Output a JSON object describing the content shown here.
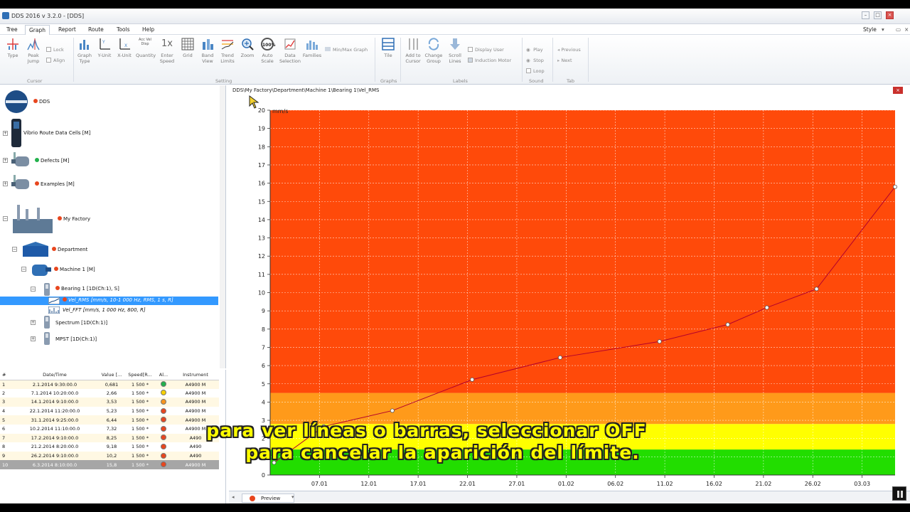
{
  "window": {
    "title": "DDS 2016 v 3.2.0 - [DDS]",
    "style_label": "Style"
  },
  "menu": {
    "tabs": [
      "Tree",
      "Graph",
      "Report",
      "Route",
      "Tools",
      "Help"
    ],
    "active": "Graph"
  },
  "ribbon": {
    "cursor": {
      "type": "Type",
      "peak_jump": "Peak Jump",
      "lock": "Lock",
      "align": "Align",
      "group": "Cursor"
    },
    "setting": {
      "graph_type": "Graph Type",
      "y_unit": "Y-Unit",
      "x_unit": "X-Unit",
      "quantity": "Quantity",
      "quantity_icon": "Acc Vel Disp",
      "enter_speed": "Enter Speed",
      "enter_speed_icon": "1x",
      "grid": "Grid",
      "band_view": "Band View",
      "trend_limits": "Trend Limits",
      "zoom": "Zoom",
      "auto_scale": "Auto Scale",
      "auto_scale_icon": "100%",
      "data_selection": "Data Selection",
      "families": "Families",
      "minmax": "Min/Max Graph",
      "group": "Setting"
    },
    "graphs": {
      "tile": "Tile",
      "group": "Graphs"
    },
    "labels": {
      "add_to_cursor": "Add to Cursor",
      "change_group": "Change Group",
      "scroll_lines": "Scroll Lines",
      "display_user": "Display User",
      "induction_motor": "Induction Motor",
      "group": "Labels"
    },
    "sound": {
      "play": "Play",
      "stop": "Stop",
      "loop": "Loop",
      "group": "Sound"
    },
    "tab": {
      "previous": "Previous",
      "next": "Next",
      "group": "Tab"
    }
  },
  "tree": {
    "root": "DDS",
    "vibrio": "Vibrio Route Data Cells [M]",
    "defects": "Defects [M]",
    "examples": "Examples [M]",
    "factory": "My Factory",
    "department": "Department",
    "machine": "Machine 1 [M]",
    "bearing": "Bearing 1 [1D(Ch:1), S]",
    "vel_rms": "Vel_RMS [mm/s, 10-1 000 Hz, RMS, 1 s, R]",
    "vel_fft": "Vel_FFT [mm/s, 1 000 Hz, 800, R]",
    "spectrum": "Spectrum [1D(Ch:1)]",
    "mpst": "MPST [1D(Ch:1)]"
  },
  "table": {
    "headers": [
      "#",
      "Date/Time",
      "Value [...",
      "Speed[R...",
      "Al...",
      "Instrument"
    ],
    "rows": [
      {
        "n": "1",
        "date": "2.1.2014 9:30:00.0",
        "value": "0,681",
        "speed": "1 500 *",
        "alarm": "#22b14c",
        "instrument": "A4900 M"
      },
      {
        "n": "2",
        "date": "7.1.2014 10:20:00.0",
        "value": "2,66",
        "speed": "1 500 *",
        "alarm": "#f6d000",
        "instrument": "A4900 M"
      },
      {
        "n": "3",
        "date": "14.1.2014 9:10:00.0",
        "value": "3,53",
        "speed": "1 500 *",
        "alarm": "#f7941d",
        "instrument": "A4900 M"
      },
      {
        "n": "4",
        "date": "22.1.2014 11:20:00.0",
        "value": "5,23",
        "speed": "1 500 *",
        "alarm": "#e8461e",
        "instrument": "A4900 M"
      },
      {
        "n": "5",
        "date": "31.1.2014 9:25:00.0",
        "value": "6,44",
        "speed": "1 500 *",
        "alarm": "#e8461e",
        "instrument": "A4900 M"
      },
      {
        "n": "6",
        "date": "10.2.2014 11:10:00.0",
        "value": "7,32",
        "speed": "1 500 *",
        "alarm": "#e8461e",
        "instrument": "A4900 M"
      },
      {
        "n": "7",
        "date": "17.2.2014 9:10:00.0",
        "value": "8,25",
        "speed": "1 500 *",
        "alarm": "#e8461e",
        "instrument": "A490"
      },
      {
        "n": "8",
        "date": "21.2.2014 8:20:00.0",
        "value": "9,18",
        "speed": "1 500 *",
        "alarm": "#e8461e",
        "instrument": "A490"
      },
      {
        "n": "9",
        "date": "26.2.2014 9:10:00.0",
        "value": "10,2",
        "speed": "1 500 *",
        "alarm": "#e8461e",
        "instrument": "A490"
      },
      {
        "n": "10",
        "date": "6.3.2014 8:10:00.0",
        "value": "15,8",
        "speed": "1 500 *",
        "alarm": "#e8461e",
        "instrument": "A4900 M"
      }
    ]
  },
  "graph": {
    "path": "DDS\\My Factory\\Department\\Machine 1\\Bearing 1\\Vel_RMS",
    "preview_tab": "Preview"
  },
  "chart_data": {
    "type": "line",
    "ylabel": "mm/s",
    "ylim": [
      0,
      20
    ],
    "yticks": [
      "0",
      "1",
      "2",
      "3",
      "4",
      "5",
      "6",
      "7",
      "8",
      "9",
      "10",
      "11",
      "12",
      "13",
      "14",
      "15",
      "16",
      "17",
      "18",
      "19",
      "20"
    ],
    "x_start_label": "02.01.2014",
    "x_end_label": "06.03.2014",
    "xticks": [
      {
        "date": "2014-01-07",
        "label": "07.01"
      },
      {
        "date": "2014-01-12",
        "label": "12.01"
      },
      {
        "date": "2014-01-17",
        "label": "17.01"
      },
      {
        "date": "2014-01-22",
        "label": "22.01"
      },
      {
        "date": "2014-01-27",
        "label": "27.01"
      },
      {
        "date": "2014-02-01",
        "label": "01.02"
      },
      {
        "date": "2014-02-06",
        "label": "06.02"
      },
      {
        "date": "2014-02-11",
        "label": "11.02"
      },
      {
        "date": "2014-02-16",
        "label": "16.02"
      },
      {
        "date": "2014-02-21",
        "label": "21.02"
      },
      {
        "date": "2014-02-26",
        "label": "26.02"
      },
      {
        "date": "2014-03-03",
        "label": "03.03"
      }
    ],
    "x": [
      "2014-01-02 09:30",
      "2014-01-07 10:20",
      "2014-01-14 09:10",
      "2014-01-22 11:20",
      "2014-01-31 09:25",
      "2014-02-10 11:10",
      "2014-02-17 09:10",
      "2014-02-21 08:20",
      "2014-02-26 09:10",
      "2014-03-06 08:10"
    ],
    "values": [
      0.681,
      2.66,
      3.53,
      5.23,
      6.44,
      7.32,
      8.25,
      9.18,
      10.2,
      15.8
    ],
    "line_color": "#b3002d",
    "limit_bands": [
      {
        "from": 0,
        "to": 1.4,
        "color": "#22dd00"
      },
      {
        "from": 1.4,
        "to": 2.8,
        "color": "#ffff00"
      },
      {
        "from": 2.8,
        "to": 4.5,
        "color": "#ff9a1a"
      },
      {
        "from": 4.5,
        "to": 20,
        "color": "#ff4a0a"
      }
    ],
    "grid": true
  },
  "subtitle": {
    "line1": "para ver líneas o barras, seleccionar OFF",
    "line2": "para cancelar la aparición del límite."
  }
}
